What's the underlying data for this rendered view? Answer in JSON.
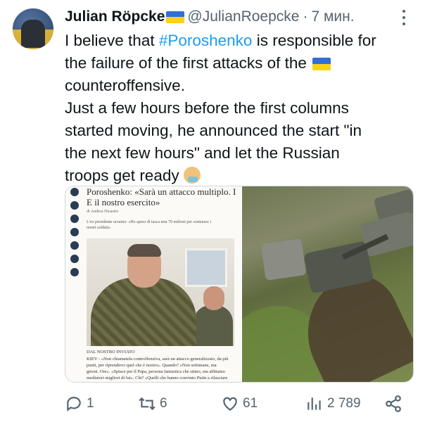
{
  "tweet": {
    "author_name": "Julian Röpcke",
    "author_flag": "ukraine-flag",
    "handle": "@JulianRoepcke",
    "separator": "·",
    "time": "7 мин.",
    "text_lines": [
      [
        "I believe that ",
        "#Poroshenko",
        " is responsible for"
      ],
      [
        "the failure of the first attacks of the "
      ],
      [
        "counteroffensive."
      ],
      [
        "Just a few hours before the first columns"
      ],
      [
        "started moving, he announced the start \"in"
      ],
      [
        "the next few hours\" and let the Russian"
      ],
      [
        "troops get ready "
      ]
    ],
    "hashtag": "#Poroshenko"
  },
  "media": {
    "article_headline_1": "Poroshenko: «Sarà un attacco multiplo. I",
    "article_headline_2": "E il nostro esercito»",
    "article_byline": "di Andrea Nicastro",
    "article_sub_1": "L'ex presidente ucraino: «Ho speso di tasca mia 70 milioni per sostenere i",
    "article_sub_2": "nostri soldati»",
    "article_dal": "DAL NOSTRO INVIATO",
    "article_body_1": "KIEV - «Non chiamatela controffensiva, sarà un attacco generalizzato, da più",
    "article_body_2": "punti, per riprenderci quel che è nostro». Quando? «Non settimane, ma",
    "article_body_3": "giorni. Ore». «Spiace per il Papa, persona fantastica che stimo, ma abbiamo",
    "article_body_4": "mediatori migliori di lui». Chi? «Quelli che hanno convinto Putin a rilasciare"
  },
  "actions": {
    "replies": "1",
    "retweets": "6",
    "likes": "61",
    "views": "2 789"
  },
  "icons": {
    "reply": "reply-icon",
    "retweet": "retweet-icon",
    "like": "heart-icon",
    "views": "views-icon",
    "share": "share-icon",
    "more": "more-icon"
  }
}
